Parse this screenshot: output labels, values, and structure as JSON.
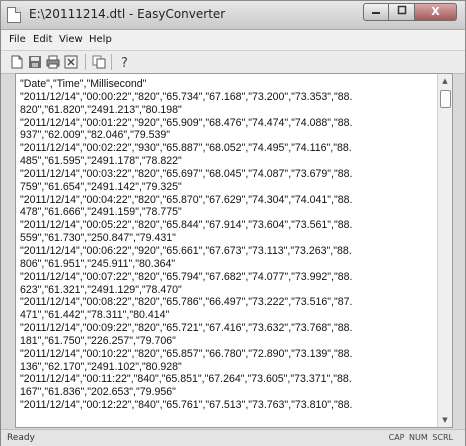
{
  "window": {
    "title": "E:\\20111214.dtl - EasyConverter",
    "minimize_icon": "minimize-icon",
    "maximize_icon": "maximize-icon",
    "close_icon": "close-icon",
    "close_glyph": "X"
  },
  "menu": {
    "items": [
      {
        "label": "File"
      },
      {
        "label": "Edit"
      },
      {
        "label": "View"
      },
      {
        "label": "Help"
      }
    ]
  },
  "toolbar": {
    "buttons": [
      "new-document-icon",
      "save-icon",
      "print-icon",
      "close-document-icon",
      "copy-icon",
      "help-icon"
    ]
  },
  "document": {
    "lines": [
      "\"Date\",\"Time\",\"Millisecond\"",
      "\"2011/12/14\",\"00:00:22\",\"820\",\"65.734\",\"67.168\",\"73.200\",\"73.353\",\"88.",
      "820\",\"61.820\",\"2491.213\",\"80.198\"",
      "\"2011/12/14\",\"00:01:22\",\"920\",\"65.909\",\"68.476\",\"74.474\",\"74.088\",\"88.",
      "937\",\"62.009\",\"82.046\",\"79.539\"",
      "\"2011/12/14\",\"00:02:22\",\"930\",\"65.887\",\"68.052\",\"74.495\",\"74.116\",\"88.",
      "485\",\"61.595\",\"2491.178\",\"78.822\"",
      "\"2011/12/14\",\"00:03:22\",\"820\",\"65.697\",\"68.045\",\"74.087\",\"73.679\",\"88.",
      "759\",\"61.654\",\"2491.142\",\"79.325\"",
      "\"2011/12/14\",\"00:04:22\",\"820\",\"65.870\",\"67.629\",\"74.304\",\"74.041\",\"88.",
      "478\",\"61.666\",\"2491.159\",\"78.775\"",
      "\"2011/12/14\",\"00:05:22\",\"820\",\"65.844\",\"67.914\",\"73.604\",\"73.561\",\"88.",
      "559\",\"61.730\",\"250.847\",\"79.431\"",
      "\"2011/12/14\",\"00:06:22\",\"920\",\"65.661\",\"67.673\",\"73.113\",\"73.263\",\"88.",
      "806\",\"61.951\",\"245.911\",\"80.364\"",
      "\"2011/12/14\",\"00:07:22\",\"820\",\"65.794\",\"67.682\",\"74.077\",\"73.992\",\"88.",
      "623\",\"61.321\",\"2491.129\",\"78.470\"",
      "\"2011/12/14\",\"00:08:22\",\"820\",\"65.786\",\"66.497\",\"73.222\",\"73.516\",\"87.",
      "471\",\"61.442\",\"78.311\",\"80.414\"",
      "\"2011/12/14\",\"00:09:22\",\"820\",\"65.721\",\"67.416\",\"73.632\",\"73.768\",\"88.",
      "181\",\"61.750\",\"226.257\",\"79.706\"",
      "\"2011/12/14\",\"00:10:22\",\"820\",\"65.857\",\"66.780\",\"72.890\",\"73.139\",\"88.",
      "136\",\"62.170\",\"2491.102\",\"80.928\"",
      "\"2011/12/14\",\"00:11:22\",\"840\",\"65.851\",\"67.264\",\"73.605\",\"73.371\",\"88.",
      "167\",\"61.836\",\"202.653\",\"79.956\"",
      "\"2011/12/14\",\"00:12:22\",\"840\",\"65.761\",\"67.513\",\"73.763\",\"73.810\",\"88."
    ]
  },
  "status": {
    "text": "Ready",
    "indicators": "CAP NUM SCRL"
  }
}
